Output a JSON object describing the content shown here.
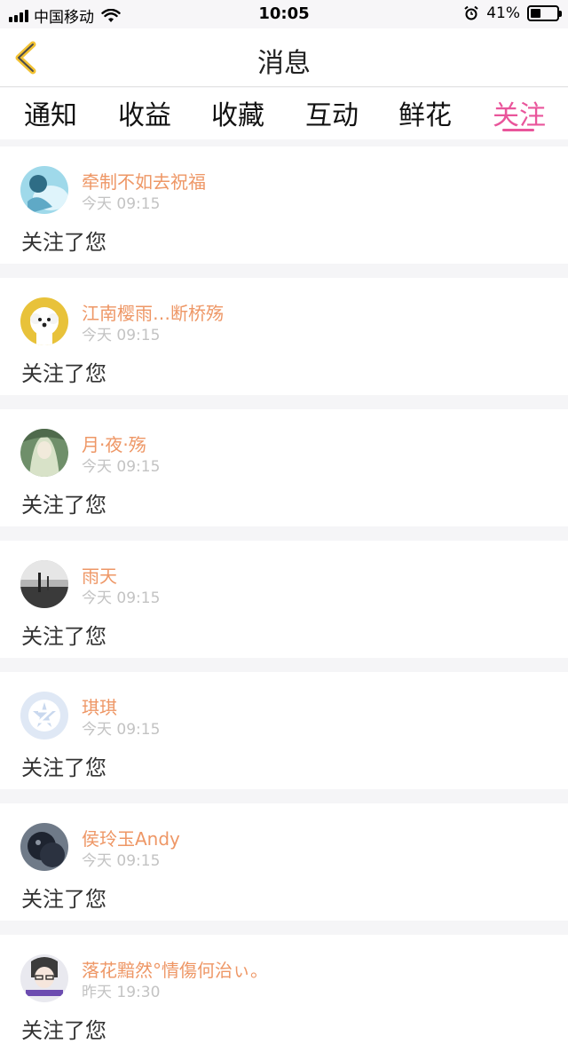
{
  "status": {
    "carrier": "中国移动",
    "time": "10:05",
    "battery_percent": "41%",
    "battery_level": 0.41,
    "signal_bars": 4
  },
  "header": {
    "title": "消息",
    "back_icon": "chevron-left-icon",
    "accent_color": "#f2c233"
  },
  "tabs": [
    {
      "label": "通知",
      "active": false
    },
    {
      "label": "收益",
      "active": false
    },
    {
      "label": "收藏",
      "active": false
    },
    {
      "label": "互动",
      "active": false
    },
    {
      "label": "鲜花",
      "active": false
    },
    {
      "label": "关注",
      "active": true
    }
  ],
  "colors": {
    "active_tab": "#e9559b",
    "name": "#ee9766",
    "timestamp": "#c3c3c3"
  },
  "messages": [
    {
      "name": "牵制不如去祝福",
      "time": "今天 09:15",
      "text": "关注了您",
      "avatar_palette": [
        "#9fd9ea",
        "#2f6d86"
      ]
    },
    {
      "name": "江南樱雨…断桥殇",
      "time": "今天 09:15",
      "text": "关注了您",
      "avatar_palette": [
        "#e8c23a",
        "#ffffff"
      ]
    },
    {
      "name": "月·夜·殇",
      "time": "今天 09:15",
      "text": "关注了您",
      "avatar_palette": [
        "#6f8f6a",
        "#d8e2c8"
      ]
    },
    {
      "name": "雨天",
      "time": "今天 09:15",
      "text": "关注了您",
      "avatar_palette": [
        "#b5b5b5",
        "#3a3a3a"
      ]
    },
    {
      "name": "琪琪",
      "time": "今天 09:15",
      "text": "关注了您",
      "avatar_palette": [
        "#dfe8f5",
        "#ffffff"
      ]
    },
    {
      "name": "侯玲玉Andy",
      "time": "今天 09:15",
      "text": "关注了您",
      "avatar_palette": [
        "#1e2430",
        "#6f7a88"
      ]
    },
    {
      "name": "落花黯然°情傷何治ぃ。",
      "time": "昨天 19:30",
      "text": "关注了您",
      "avatar_palette": [
        "#e9e9ef",
        "#6c4cb0"
      ]
    }
  ]
}
